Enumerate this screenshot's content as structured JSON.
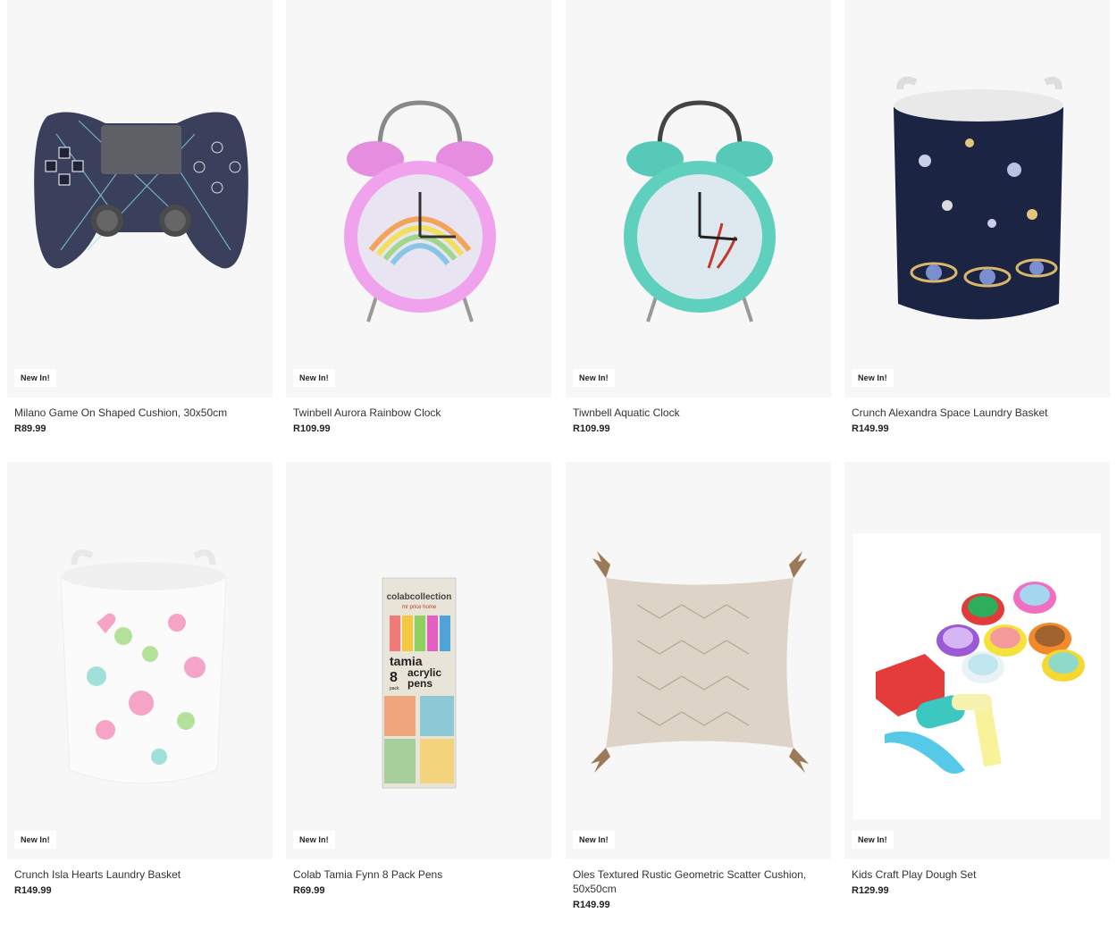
{
  "products": [
    {
      "badge": "New In!",
      "name": "Milano Game On Shaped Cushion, 30x50cm",
      "price": "R89.99",
      "icon": "game-controller-cushion"
    },
    {
      "badge": "New In!",
      "name": "Twinbell Aurora Rainbow Clock",
      "price": "R109.99",
      "icon": "pink-alarm-clock"
    },
    {
      "badge": "New In!",
      "name": "Tiwnbell Aquatic Clock",
      "price": "R109.99",
      "icon": "teal-alarm-clock"
    },
    {
      "badge": "New In!",
      "name": "Crunch Alexandra Space Laundry Basket",
      "price": "R149.99",
      "icon": "space-laundry-basket"
    },
    {
      "badge": "New In!",
      "name": "Crunch Isla Hearts Laundry Basket",
      "price": "R149.99",
      "icon": "hearts-laundry-basket"
    },
    {
      "badge": "New In!",
      "name": "Colab Tamia Fynn 8 Pack Pens",
      "price": "R69.99",
      "icon": "acrylic-pens-pack",
      "package": {
        "brand": "colabcollection",
        "sub": "mr price home",
        "title": "tamia",
        "count": "8",
        "pack": "pack",
        "line1": "acrylic",
        "line2": "pens"
      }
    },
    {
      "badge": "New In!",
      "name": "Oles Textured Rustic Geometric Scatter Cushion, 50x50cm",
      "price": "R149.99",
      "icon": "scatter-cushion"
    },
    {
      "badge": "New In!",
      "name": "Kids Craft Play Dough Set",
      "price": "R129.99",
      "icon": "play-dough-set"
    }
  ],
  "colors": {
    "tile_bg": "#f7f7f7",
    "badge_bg": "#ffffff",
    "text": "#333333"
  }
}
